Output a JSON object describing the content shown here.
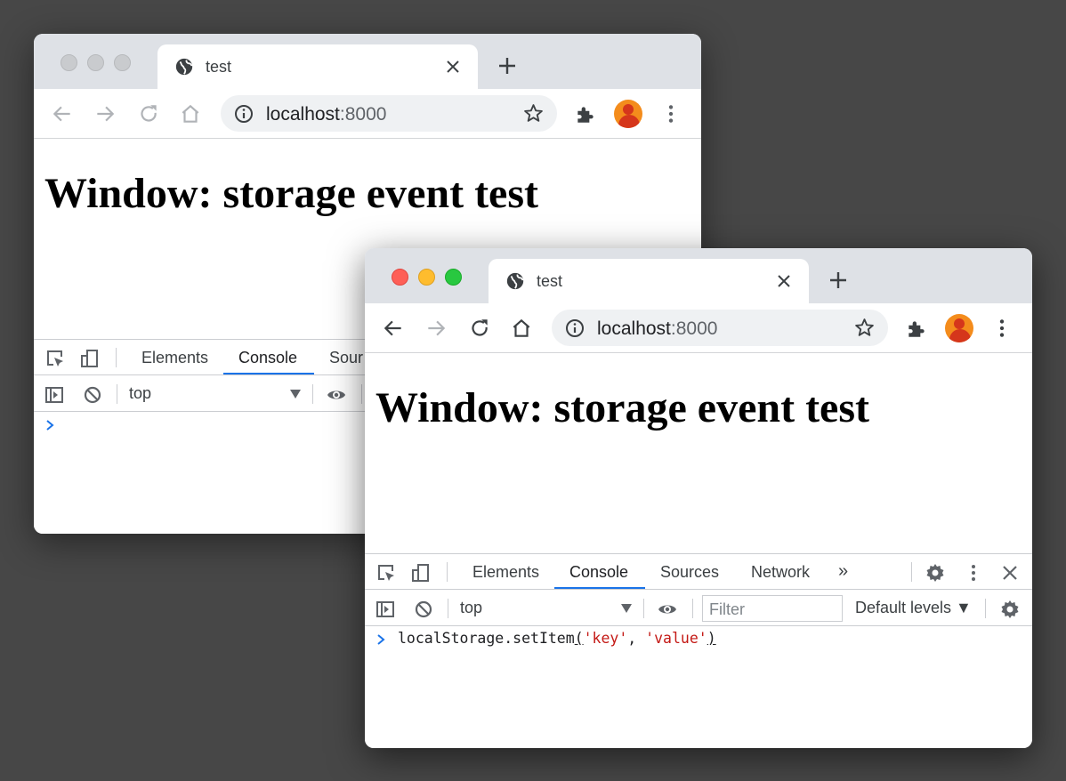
{
  "windows": [
    {
      "tab_title": "test",
      "url_host": "localhost",
      "url_port": ":8000",
      "heading": "Window: storage event test",
      "devtools": {
        "tabs": [
          "Elements",
          "Console",
          "Sour"
        ],
        "active_tab": "Console",
        "context": "top"
      }
    },
    {
      "tab_title": "test",
      "url_host": "localhost",
      "url_port": ":8000",
      "heading": "Window: storage event test",
      "devtools": {
        "tabs": [
          "Elements",
          "Console",
          "Sources",
          "Network"
        ],
        "active_tab": "Console",
        "more_tabs": "»",
        "context": "top",
        "filter_placeholder": "Filter",
        "levels": "Default levels ▼",
        "console_input": {
          "fn": "localStorage.setItem",
          "open_paren": "(",
          "arg1": "'key'",
          "comma": ", ",
          "arg2": "'value'",
          "close_paren": ")"
        }
      }
    }
  ],
  "colors": {
    "desktop": "#474747",
    "tab_strip": "#dee1e6",
    "active_tab_underline": "#1a73e8",
    "string_literal": "#c41a16",
    "avatar": "#f48c1c"
  },
  "icons": [
    "globe-icon",
    "close-icon",
    "new-tab-icon",
    "back-icon",
    "forward-icon",
    "reload-icon",
    "home-icon",
    "info-icon",
    "star-icon",
    "extensions-icon",
    "inspect-icon",
    "device-toggle-icon",
    "sidebar-icon",
    "clear-console-icon",
    "eye-icon",
    "settings-icon",
    "more-vert-icon",
    "prompt-icon"
  ]
}
